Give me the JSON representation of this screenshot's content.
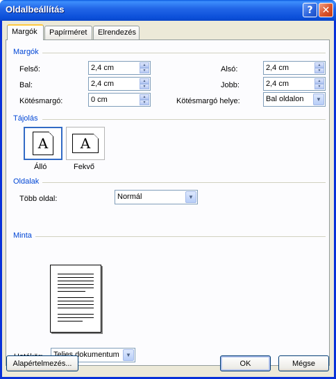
{
  "window": {
    "title": "Oldalbeállítás"
  },
  "tabs": [
    {
      "label": "Margók"
    },
    {
      "label": "Papírméret"
    },
    {
      "label": "Elrendezés"
    }
  ],
  "margins": {
    "group_label": "Margók",
    "top_label": "Felső:",
    "top_value": "2,4 cm",
    "bottom_label": "Alsó:",
    "bottom_value": "2,4 cm",
    "left_label": "Bal:",
    "left_value": "2,4 cm",
    "right_label": "Jobb:",
    "right_value": "2,4 cm",
    "gutter_label": "Kötésmargó:",
    "gutter_value": "0 cm",
    "gutter_pos_label": "Kötésmargó helye:",
    "gutter_pos_value": "Bal oldalon"
  },
  "orientation": {
    "group_label": "Tájolás",
    "portrait_label": "Álló",
    "landscape_label": "Fekvő",
    "icon_letter": "A",
    "selected": "portrait"
  },
  "pages": {
    "group_label": "Oldalak",
    "multiple_label": "Több oldal:",
    "multiple_value": "Normál"
  },
  "preview": {
    "group_label": "Minta",
    "apply_label": "Hatókör:",
    "apply_value": "Teljes dokumentum"
  },
  "buttons": {
    "default_label": "Alapértelmezés...",
    "ok_label": "OK",
    "cancel_label": "Mégse"
  },
  "colors": {
    "accent": "#0046d5",
    "titlebar": "#0a5ae0",
    "close": "#d9542b"
  }
}
